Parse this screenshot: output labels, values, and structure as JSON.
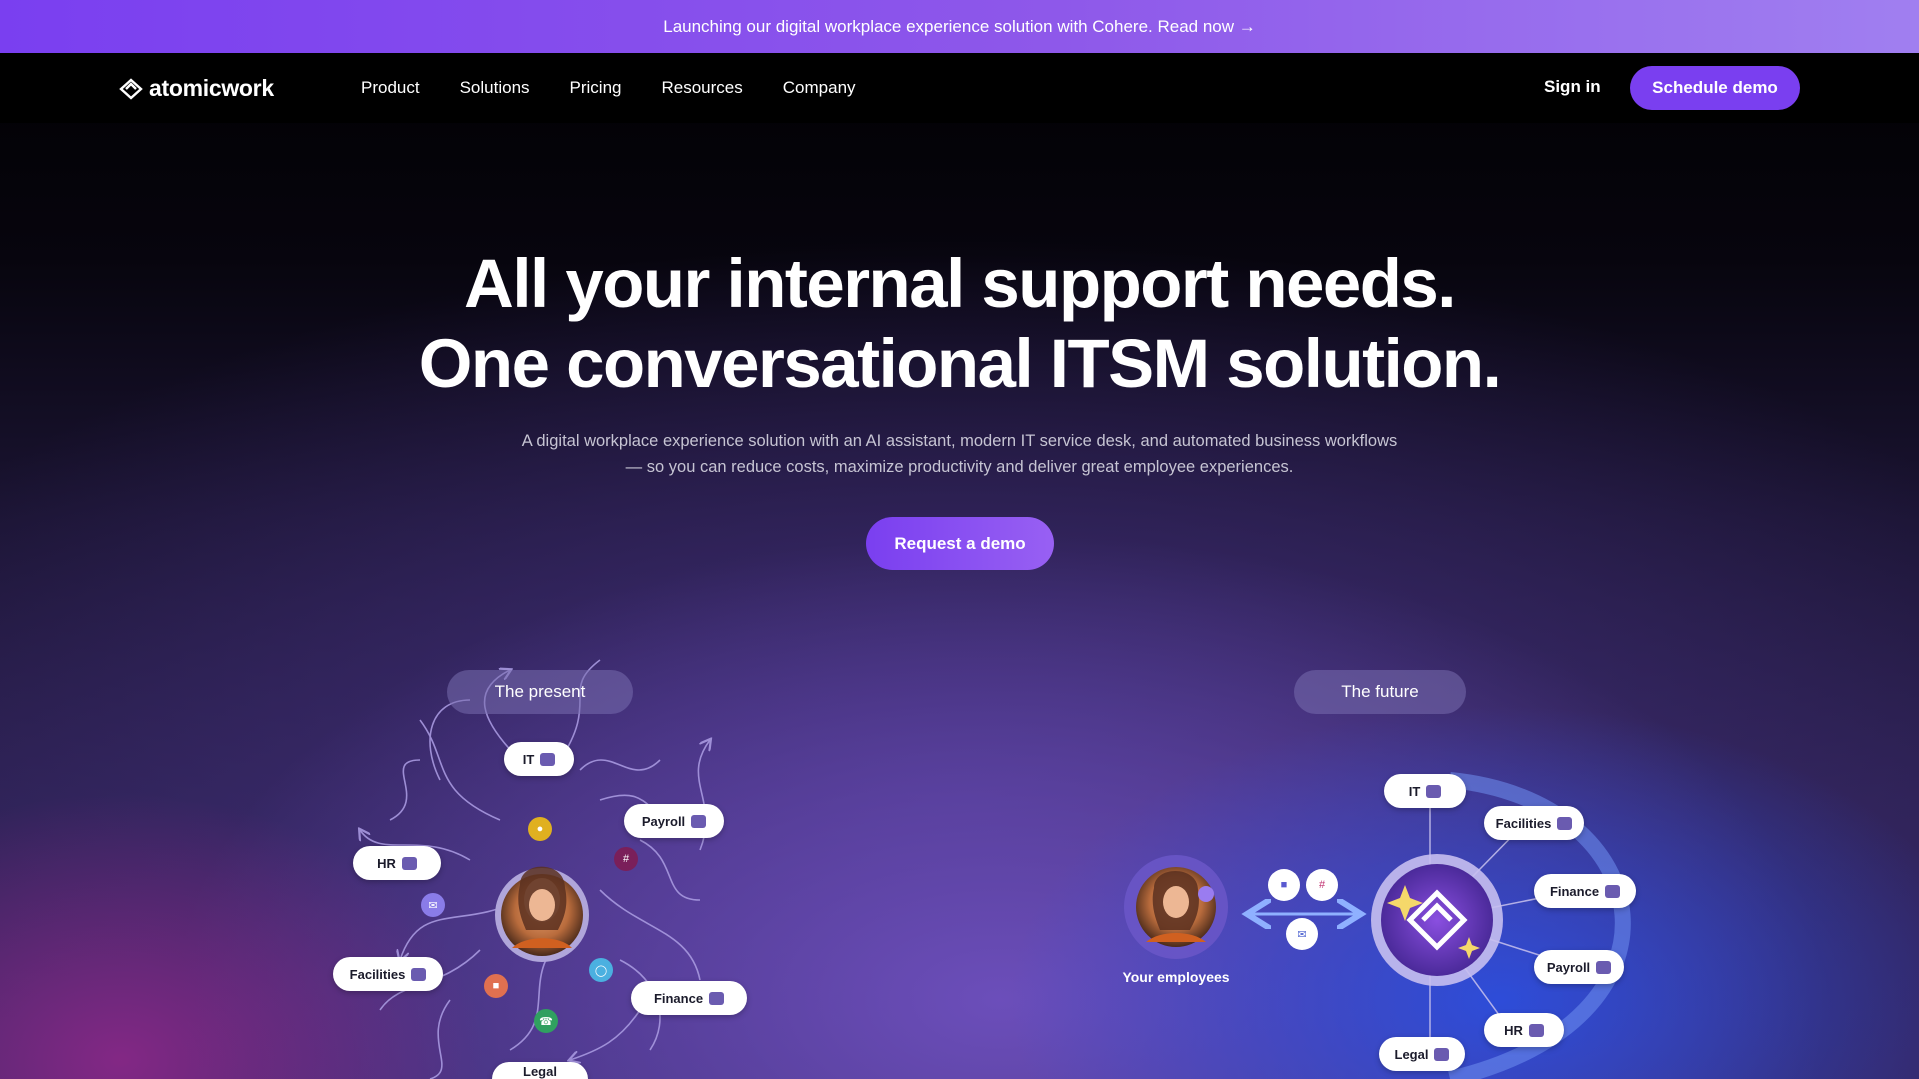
{
  "banner": {
    "text": "Launching our digital workplace experience solution with Cohere. Read now →"
  },
  "nav": {
    "logo_text": "atomicwork",
    "links": [
      "Product",
      "Solutions",
      "Pricing",
      "Resources",
      "Company"
    ],
    "signin": "Sign in",
    "cta": "Schedule demo"
  },
  "hero": {
    "title_line1": "All your internal support needs.",
    "title_line2": "One conversational ITSM solution.",
    "subtitle_line1": "A digital workplace experience solution with an AI assistant, modern IT service desk, and automated business workflows",
    "subtitle_line2": "— so you can reduce costs, maximize productivity and deliver great employee experiences.",
    "cta": "Request a demo"
  },
  "present": {
    "label": "The present",
    "tags": {
      "it": "IT",
      "payroll": "Payroll",
      "hr": "HR",
      "facilities": "Facilities",
      "finance": "Finance",
      "legal": "Legal"
    },
    "icons": [
      "headset-icon",
      "slack-icon",
      "mail-icon",
      "video-icon",
      "phone-icon",
      "globe-icon"
    ]
  },
  "future": {
    "label": "The future",
    "caption": "Your employees",
    "tags": {
      "it": "IT",
      "facilities": "Facilities",
      "finance": "Finance",
      "payroll": "Payroll",
      "hr": "HR",
      "legal": "Legal"
    },
    "icons": [
      "teams-icon",
      "slack-icon",
      "mail-icon"
    ]
  },
  "colors": {
    "accent": "#7a3ff0",
    "banner_start": "#7a3ff0",
    "banner_end": "#a07ff0",
    "background": "#000000",
    "blue_glow": "#2850e6"
  }
}
